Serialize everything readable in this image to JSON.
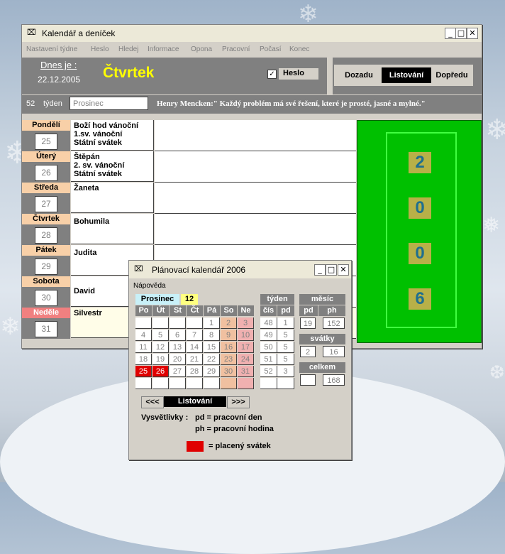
{
  "main": {
    "title": "Kalendář a deníček",
    "menu": [
      "Nastavení týdne",
      "Heslo",
      "Hledej",
      "Informace",
      "Opona",
      "Pracovní",
      "Počasí",
      "Konec"
    ],
    "today_label": "Dnes je :",
    "today_date": "22.12.2005",
    "today_day": "Čtvrtek",
    "password_label": "Heslo",
    "password_checked": "✓",
    "nav": {
      "back": "Dozadu",
      "browse": "Listování",
      "forward": "Dopředu"
    },
    "week_number": "52",
    "week_label": "týden",
    "month": "Prosinec",
    "quote": "Henry Mencken:\" Každý problém má své řešení, které je prosté, jasné a mylné.\"",
    "days": [
      {
        "name": "Pondělí",
        "num": "25",
        "text": "Boží hod vánoční\n1.sv. vánoční\nStátní svátek"
      },
      {
        "name": "Úterý",
        "num": "26",
        "text": "Štěpán\n2. sv. vánoční\nStátní svátek"
      },
      {
        "name": "Středa",
        "num": "27",
        "text": "Žaneta"
      },
      {
        "name": "Čtvrtek",
        "num": "28",
        "text": "Bohumila"
      },
      {
        "name": "Pátek",
        "num": "29",
        "text": "Judita"
      },
      {
        "name": "Sobota",
        "num": "30",
        "text": "David"
      },
      {
        "name": "Neděle",
        "num": "31",
        "text": "Silvestr"
      }
    ],
    "year_digits": [
      "2",
      "0",
      "0",
      "6"
    ]
  },
  "planner": {
    "title": "Plánovací kalendář 2006",
    "menu": "Nápověda",
    "month": "Prosinec",
    "month_num": "12",
    "weekday_headers": [
      "Po",
      "Út",
      "St",
      "Čt",
      "Pá",
      "So",
      "Ne"
    ],
    "weeks": [
      [
        "",
        "",
        "",
        "",
        "1",
        "2",
        "3"
      ],
      [
        "4",
        "5",
        "6",
        "7",
        "8",
        "9",
        "10"
      ],
      [
        "11",
        "12",
        "13",
        "14",
        "15",
        "16",
        "17"
      ],
      [
        "18",
        "19",
        "20",
        "21",
        "22",
        "23",
        "24"
      ],
      [
        "25",
        "26",
        "27",
        "28",
        "29",
        "30",
        "31"
      ],
      [
        "",
        "",
        "",
        "",
        "",
        "",
        ""
      ]
    ],
    "week_header": "týden",
    "week_cols": [
      "čís",
      "pd"
    ],
    "week_rows": [
      [
        "48",
        "1"
      ],
      [
        "49",
        "5"
      ],
      [
        "50",
        "5"
      ],
      [
        "51",
        "5"
      ],
      [
        "52",
        "3"
      ],
      [
        "",
        ""
      ]
    ],
    "month_header": "měsíc",
    "month_cols": [
      "pd",
      "ph"
    ],
    "month_values": [
      "19",
      "152"
    ],
    "holidays_header": "svátky",
    "holidays_values": [
      "2",
      "16"
    ],
    "total_header": "celkem",
    "total_values": [
      "",
      "168"
    ],
    "nav_prev": "<<<",
    "nav_label": "Listování",
    "nav_next": ">>>",
    "legend_title": "Vysvětlivky :",
    "legend_pd": "pd = pracovní den",
    "legend_ph": "ph = pracovní hodina",
    "legend_paid": "= placený svátek",
    "colors": {
      "paid_holiday": "#e00000",
      "weekend": "#f0c0a0",
      "sunday": "#f0b0b0",
      "header": "#808080",
      "year_green": "#00c000"
    }
  }
}
